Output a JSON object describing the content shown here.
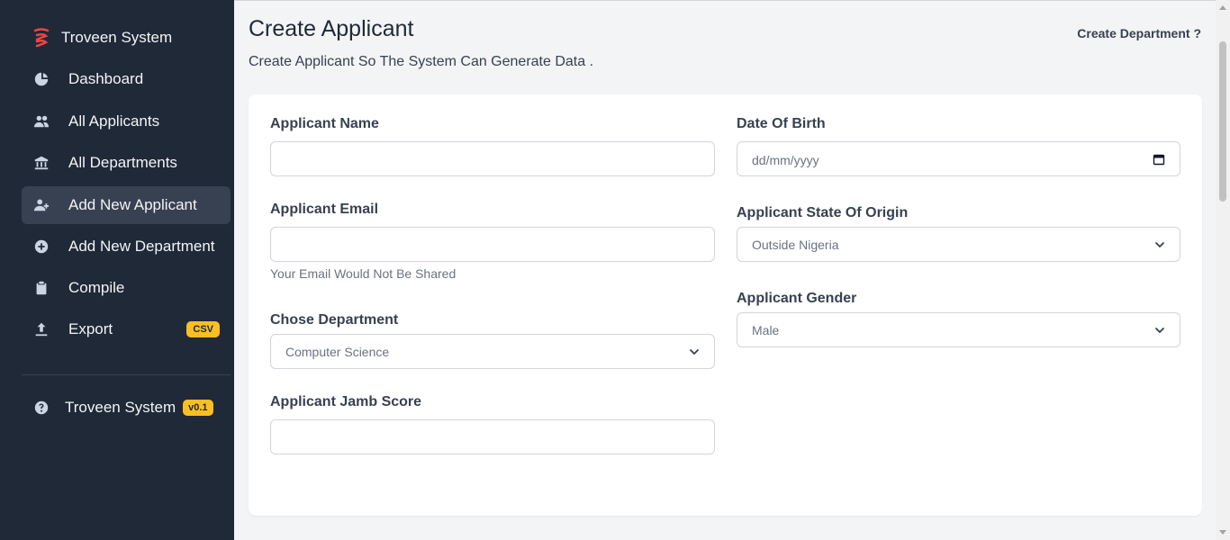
{
  "sidebar": {
    "brand": "Troveen System",
    "items": [
      {
        "label": "Dashboard",
        "icon": "pie-chart-icon"
      },
      {
        "label": "All Applicants",
        "icon": "users-icon"
      },
      {
        "label": "All Departments",
        "icon": "library-icon"
      },
      {
        "label": "Add New Applicant",
        "icon": "user-add-icon",
        "active": true
      },
      {
        "label": "Add New Department",
        "icon": "plus-circle-icon"
      },
      {
        "label": "Compile",
        "icon": "clipboard-icon"
      },
      {
        "label": "Export",
        "icon": "upload-icon",
        "badge": "CSV"
      }
    ],
    "footer": {
      "label": "Troveen System",
      "badge": "v0.1",
      "icon": "question-circle-icon"
    }
  },
  "header": {
    "title": "Create Applicant",
    "subtitle": "Create Applicant So The System Can Generate Data .",
    "link": "Create Department ?"
  },
  "form": {
    "name_label": "Applicant Name",
    "name_value": "",
    "email_label": "Applicant Email",
    "email_value": "",
    "email_hint": "Your Email Would Not Be Shared",
    "department_label": "Chose Department",
    "department_value": "Computer Science",
    "jamb_label": "Applicant Jamb Score",
    "jamb_value": "",
    "dob_label": "Date Of Birth",
    "dob_placeholder": "dd/mm/yyyy",
    "state_label": "Applicant State Of Origin",
    "state_value": "Outside Nigeria",
    "gender_label": "Applicant Gender",
    "gender_value": "Male"
  },
  "colors": {
    "sidebar_bg": "#1f2937",
    "accent": "#fbbf24",
    "logo": "#ef4444"
  }
}
